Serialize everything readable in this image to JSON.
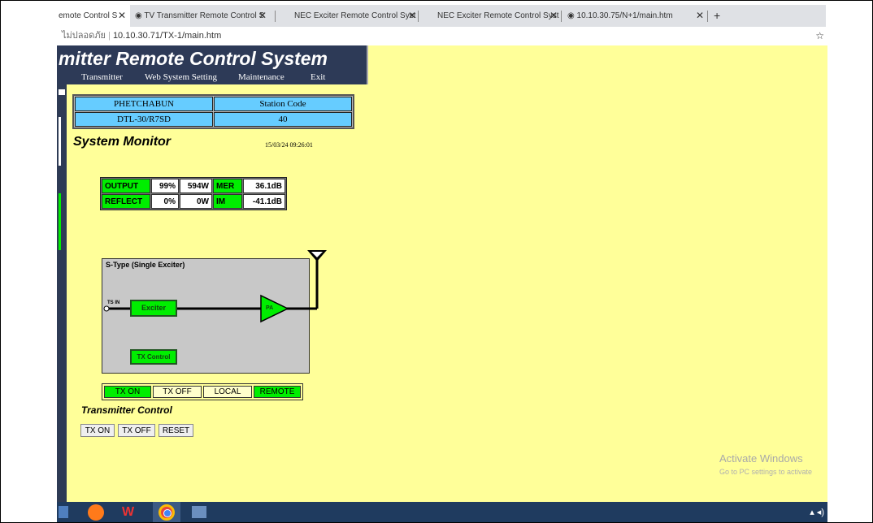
{
  "browser": {
    "tabs": [
      {
        "label": "emote Control S",
        "active": true
      },
      {
        "label": "TV Transmitter Remote Control S",
        "active": false
      },
      {
        "label": "NEC Exciter Remote Control Syst",
        "active": false
      },
      {
        "label": "NEC Exciter Remote Control Syst",
        "active": false
      },
      {
        "label": "10.10.30.75/N+1/main.htm",
        "active": false
      }
    ],
    "new_tab": "+",
    "security_label": "ไม่ปลอดภัย",
    "url": "10.10.30.71/TX-1/main.htm"
  },
  "header": {
    "title": "mitter Remote Control System",
    "menu": [
      "Transmitter",
      "Web System Setting",
      "Maintenance",
      "Exit"
    ]
  },
  "station": {
    "name": "PHETCHABUN",
    "code_label": "Station Code",
    "model": "DTL-30/R7SD",
    "code": "40"
  },
  "monitor": {
    "title": "System Monitor",
    "timestamp": "15/03/24 09:26:01",
    "output_label": "OUTPUT",
    "output_pct": "99%",
    "output_power": "594W",
    "mer_label": "MER",
    "mer_value": "36.1dB",
    "reflect_label": "REFLECT",
    "reflect_pct": "0%",
    "reflect_power": "0W",
    "im_label": "IM",
    "im_value": "-41.1dB"
  },
  "diagram": {
    "title": "S-Type (Single Exciter)",
    "ts_in": "TS IN",
    "exciter": "Exciter",
    "pa": "PA",
    "tx_control": "TX Control"
  },
  "status": {
    "tx_on": "TX ON",
    "tx_off": "TX OFF",
    "local": "LOCAL",
    "remote": "REMOTE"
  },
  "control": {
    "title": "Transmitter Control",
    "tx_on": "TX ON",
    "tx_off": "TX OFF",
    "reset": "RESET"
  },
  "watermark": {
    "title": "Activate Windows",
    "subtitle": "Go to PC settings to activate"
  },
  "colors": {
    "ok_green": "#00ee00",
    "info_blue": "#66ccff",
    "page_yellow": "#ffff99",
    "header_navy": "#2d3a57"
  }
}
